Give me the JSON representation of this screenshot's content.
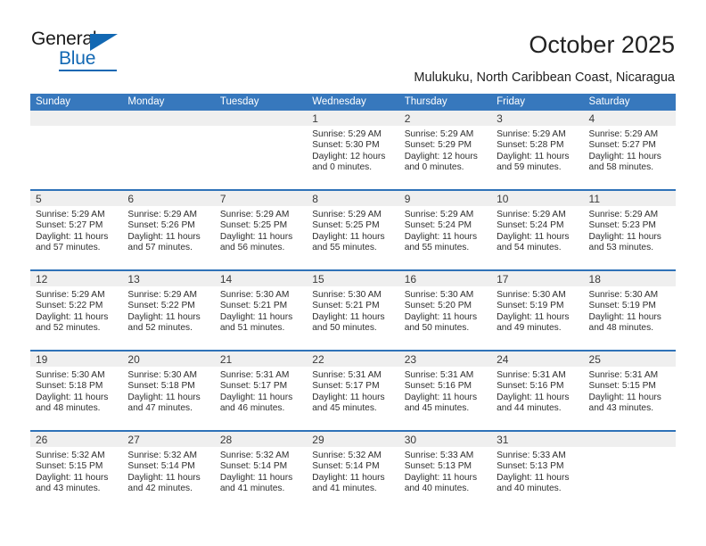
{
  "brand": {
    "name_dark": "General",
    "name_blue": "Blue",
    "accent_color": "#1268b3"
  },
  "header": {
    "title": "October 2025",
    "subtitle": "Mulukuku, North Caribbean Coast, Nicaragua"
  },
  "calendar": {
    "header_bg_color": "#3778bd",
    "week_divider_color": "#2f72b8",
    "day_band_color": "#efefef",
    "weekdays": [
      "Sunday",
      "Monday",
      "Tuesday",
      "Wednesday",
      "Thursday",
      "Friday",
      "Saturday"
    ],
    "weeks": [
      [
        {
          "day": "",
          "sunrise": "",
          "sunset": "",
          "daylight_1": "",
          "daylight_2": ""
        },
        {
          "day": "",
          "sunrise": "",
          "sunset": "",
          "daylight_1": "",
          "daylight_2": ""
        },
        {
          "day": "",
          "sunrise": "",
          "sunset": "",
          "daylight_1": "",
          "daylight_2": ""
        },
        {
          "day": "1",
          "sunrise": "Sunrise: 5:29 AM",
          "sunset": "Sunset: 5:30 PM",
          "daylight_1": "Daylight: 12 hours",
          "daylight_2": "and 0 minutes."
        },
        {
          "day": "2",
          "sunrise": "Sunrise: 5:29 AM",
          "sunset": "Sunset: 5:29 PM",
          "daylight_1": "Daylight: 12 hours",
          "daylight_2": "and 0 minutes."
        },
        {
          "day": "3",
          "sunrise": "Sunrise: 5:29 AM",
          "sunset": "Sunset: 5:28 PM",
          "daylight_1": "Daylight: 11 hours",
          "daylight_2": "and 59 minutes."
        },
        {
          "day": "4",
          "sunrise": "Sunrise: 5:29 AM",
          "sunset": "Sunset: 5:27 PM",
          "daylight_1": "Daylight: 11 hours",
          "daylight_2": "and 58 minutes."
        }
      ],
      [
        {
          "day": "5",
          "sunrise": "Sunrise: 5:29 AM",
          "sunset": "Sunset: 5:27 PM",
          "daylight_1": "Daylight: 11 hours",
          "daylight_2": "and 57 minutes."
        },
        {
          "day": "6",
          "sunrise": "Sunrise: 5:29 AM",
          "sunset": "Sunset: 5:26 PM",
          "daylight_1": "Daylight: 11 hours",
          "daylight_2": "and 57 minutes."
        },
        {
          "day": "7",
          "sunrise": "Sunrise: 5:29 AM",
          "sunset": "Sunset: 5:25 PM",
          "daylight_1": "Daylight: 11 hours",
          "daylight_2": "and 56 minutes."
        },
        {
          "day": "8",
          "sunrise": "Sunrise: 5:29 AM",
          "sunset": "Sunset: 5:25 PM",
          "daylight_1": "Daylight: 11 hours",
          "daylight_2": "and 55 minutes."
        },
        {
          "day": "9",
          "sunrise": "Sunrise: 5:29 AM",
          "sunset": "Sunset: 5:24 PM",
          "daylight_1": "Daylight: 11 hours",
          "daylight_2": "and 55 minutes."
        },
        {
          "day": "10",
          "sunrise": "Sunrise: 5:29 AM",
          "sunset": "Sunset: 5:24 PM",
          "daylight_1": "Daylight: 11 hours",
          "daylight_2": "and 54 minutes."
        },
        {
          "day": "11",
          "sunrise": "Sunrise: 5:29 AM",
          "sunset": "Sunset: 5:23 PM",
          "daylight_1": "Daylight: 11 hours",
          "daylight_2": "and 53 minutes."
        }
      ],
      [
        {
          "day": "12",
          "sunrise": "Sunrise: 5:29 AM",
          "sunset": "Sunset: 5:22 PM",
          "daylight_1": "Daylight: 11 hours",
          "daylight_2": "and 52 minutes."
        },
        {
          "day": "13",
          "sunrise": "Sunrise: 5:29 AM",
          "sunset": "Sunset: 5:22 PM",
          "daylight_1": "Daylight: 11 hours",
          "daylight_2": "and 52 minutes."
        },
        {
          "day": "14",
          "sunrise": "Sunrise: 5:30 AM",
          "sunset": "Sunset: 5:21 PM",
          "daylight_1": "Daylight: 11 hours",
          "daylight_2": "and 51 minutes."
        },
        {
          "day": "15",
          "sunrise": "Sunrise: 5:30 AM",
          "sunset": "Sunset: 5:21 PM",
          "daylight_1": "Daylight: 11 hours",
          "daylight_2": "and 50 minutes."
        },
        {
          "day": "16",
          "sunrise": "Sunrise: 5:30 AM",
          "sunset": "Sunset: 5:20 PM",
          "daylight_1": "Daylight: 11 hours",
          "daylight_2": "and 50 minutes."
        },
        {
          "day": "17",
          "sunrise": "Sunrise: 5:30 AM",
          "sunset": "Sunset: 5:19 PM",
          "daylight_1": "Daylight: 11 hours",
          "daylight_2": "and 49 minutes."
        },
        {
          "day": "18",
          "sunrise": "Sunrise: 5:30 AM",
          "sunset": "Sunset: 5:19 PM",
          "daylight_1": "Daylight: 11 hours",
          "daylight_2": "and 48 minutes."
        }
      ],
      [
        {
          "day": "19",
          "sunrise": "Sunrise: 5:30 AM",
          "sunset": "Sunset: 5:18 PM",
          "daylight_1": "Daylight: 11 hours",
          "daylight_2": "and 48 minutes."
        },
        {
          "day": "20",
          "sunrise": "Sunrise: 5:30 AM",
          "sunset": "Sunset: 5:18 PM",
          "daylight_1": "Daylight: 11 hours",
          "daylight_2": "and 47 minutes."
        },
        {
          "day": "21",
          "sunrise": "Sunrise: 5:31 AM",
          "sunset": "Sunset: 5:17 PM",
          "daylight_1": "Daylight: 11 hours",
          "daylight_2": "and 46 minutes."
        },
        {
          "day": "22",
          "sunrise": "Sunrise: 5:31 AM",
          "sunset": "Sunset: 5:17 PM",
          "daylight_1": "Daylight: 11 hours",
          "daylight_2": "and 45 minutes."
        },
        {
          "day": "23",
          "sunrise": "Sunrise: 5:31 AM",
          "sunset": "Sunset: 5:16 PM",
          "daylight_1": "Daylight: 11 hours",
          "daylight_2": "and 45 minutes."
        },
        {
          "day": "24",
          "sunrise": "Sunrise: 5:31 AM",
          "sunset": "Sunset: 5:16 PM",
          "daylight_1": "Daylight: 11 hours",
          "daylight_2": "and 44 minutes."
        },
        {
          "day": "25",
          "sunrise": "Sunrise: 5:31 AM",
          "sunset": "Sunset: 5:15 PM",
          "daylight_1": "Daylight: 11 hours",
          "daylight_2": "and 43 minutes."
        }
      ],
      [
        {
          "day": "26",
          "sunrise": "Sunrise: 5:32 AM",
          "sunset": "Sunset: 5:15 PM",
          "daylight_1": "Daylight: 11 hours",
          "daylight_2": "and 43 minutes."
        },
        {
          "day": "27",
          "sunrise": "Sunrise: 5:32 AM",
          "sunset": "Sunset: 5:14 PM",
          "daylight_1": "Daylight: 11 hours",
          "daylight_2": "and 42 minutes."
        },
        {
          "day": "28",
          "sunrise": "Sunrise: 5:32 AM",
          "sunset": "Sunset: 5:14 PM",
          "daylight_1": "Daylight: 11 hours",
          "daylight_2": "and 41 minutes."
        },
        {
          "day": "29",
          "sunrise": "Sunrise: 5:32 AM",
          "sunset": "Sunset: 5:14 PM",
          "daylight_1": "Daylight: 11 hours",
          "daylight_2": "and 41 minutes."
        },
        {
          "day": "30",
          "sunrise": "Sunrise: 5:33 AM",
          "sunset": "Sunset: 5:13 PM",
          "daylight_1": "Daylight: 11 hours",
          "daylight_2": "and 40 minutes."
        },
        {
          "day": "31",
          "sunrise": "Sunrise: 5:33 AM",
          "sunset": "Sunset: 5:13 PM",
          "daylight_1": "Daylight: 11 hours",
          "daylight_2": "and 40 minutes."
        },
        {
          "day": "",
          "sunrise": "",
          "sunset": "",
          "daylight_1": "",
          "daylight_2": ""
        }
      ]
    ]
  }
}
